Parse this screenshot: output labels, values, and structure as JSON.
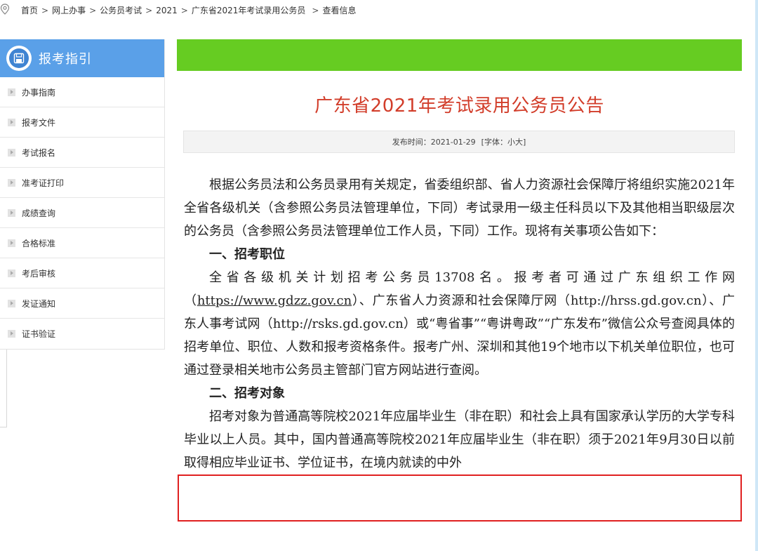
{
  "breadcrumb": {
    "items": [
      "首页",
      "网上办事",
      "公务员考试",
      "2021",
      "广东省2021年考试录用公务员",
      "查看信息"
    ],
    "separator": ">"
  },
  "sidebar": {
    "title": "报考指引",
    "items": [
      {
        "label": "办事指南"
      },
      {
        "label": "报考文件"
      },
      {
        "label": "考试报名"
      },
      {
        "label": "准考证打印"
      },
      {
        "label": "成绩查询"
      },
      {
        "label": "合格标准"
      },
      {
        "label": "考后审核"
      },
      {
        "label": "发证通知"
      },
      {
        "label": "证书验证"
      }
    ]
  },
  "article": {
    "title": "广东省2021年考试录用公务员公告",
    "meta": {
      "publish_label": "发布时间：2021-01-29",
      "font_label": "[字体：",
      "font_small": "小",
      "font_large": "大",
      "font_close": "]"
    },
    "para1": "根据公务员法和公务员录用有关规定，省委组织部、省人力资源社会保障厅将组织实施2021年全省各级机关（含参照公务员法管理单位，下同）考试录用一级主任科员以下及其他相当职级层次的公务员（含参照公务员法管理单位工作人员，下同）工作。现将有关事项公告如下：",
    "heading1": "一、招考职位",
    "para2_a": "全省各级机关计划招考公务员13708名。报考者可通过广东组织工作网（",
    "para2_link": "https://www.gdzz.gov.cn",
    "para2_b": "）、广东省人力资源和社会保障厅网（http://hrss.gd.gov.cn）、广东人事考试网（http://rsks.gd.gov.cn）或“粤省事”“粤讲粤政”“广东发布”微信公众号查阅具体的招考单位、职位、人数和报考资格条件。报考广州、深圳和其他19个地市以下机关单位职位，也可通过登录相关地市公务员主管部门官方网站进行查阅。",
    "heading2": "二、招考对象",
    "para3": "招考对象为普通高等院校2021年应届毕业生（非在职）和社会上具有国家承认学历的大学专科毕业以上人员。其中，国内普通高等院校2021年应届毕业生（非在职）须于2021年9月30日以前取得相应毕业证书、学位证书，在境内就读的中外"
  },
  "colors": {
    "sidebar_header": "#5aa0e8",
    "green_bar": "#66cc22",
    "title_red": "#d23d2a",
    "highlight_border": "#e02020"
  },
  "icons": {
    "breadcrumb": "location-pin-icon",
    "sidebar_header": "save-disk-icon",
    "sidebar_item": "chevron-right-icon"
  }
}
